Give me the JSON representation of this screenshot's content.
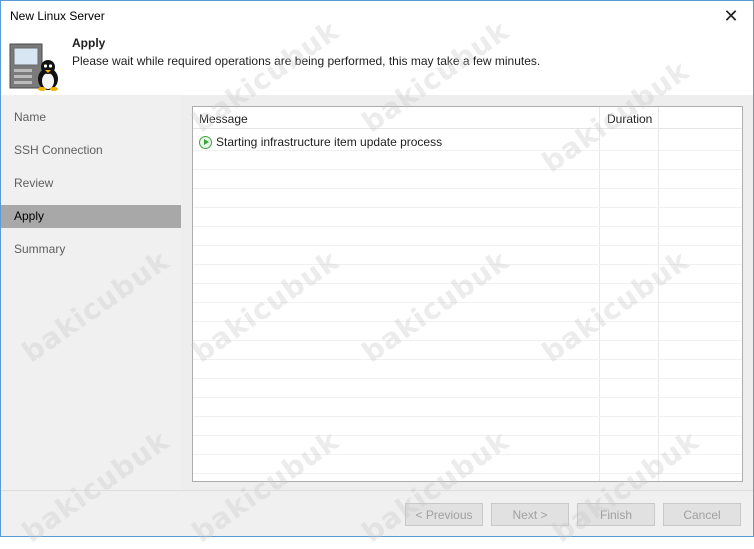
{
  "window": {
    "title": "New Linux Server",
    "close_glyph": "✕"
  },
  "header": {
    "title": "Apply",
    "subtitle": "Please wait while required operations are being performed, this may take a few minutes.",
    "icon": "linux-server-icon"
  },
  "nav": {
    "items": [
      {
        "label": "Name"
      },
      {
        "label": "SSH Connection"
      },
      {
        "label": "Review"
      },
      {
        "label": "Apply",
        "active": true
      },
      {
        "label": "Summary"
      }
    ]
  },
  "grid": {
    "columns": [
      "Message",
      "Duration"
    ],
    "rows": [
      {
        "status_icon": "play-icon",
        "message": "Starting infrastructure item update process",
        "duration": ""
      }
    ]
  },
  "buttons": {
    "previous": "< Previous",
    "next": "Next >",
    "finish": "Finish",
    "cancel": "Cancel"
  },
  "watermark": "bakicubuk",
  "colors": {
    "active_nav": "#a8a8a8",
    "accent_border": "#5b9bd5",
    "status_green": "#3da33d"
  }
}
